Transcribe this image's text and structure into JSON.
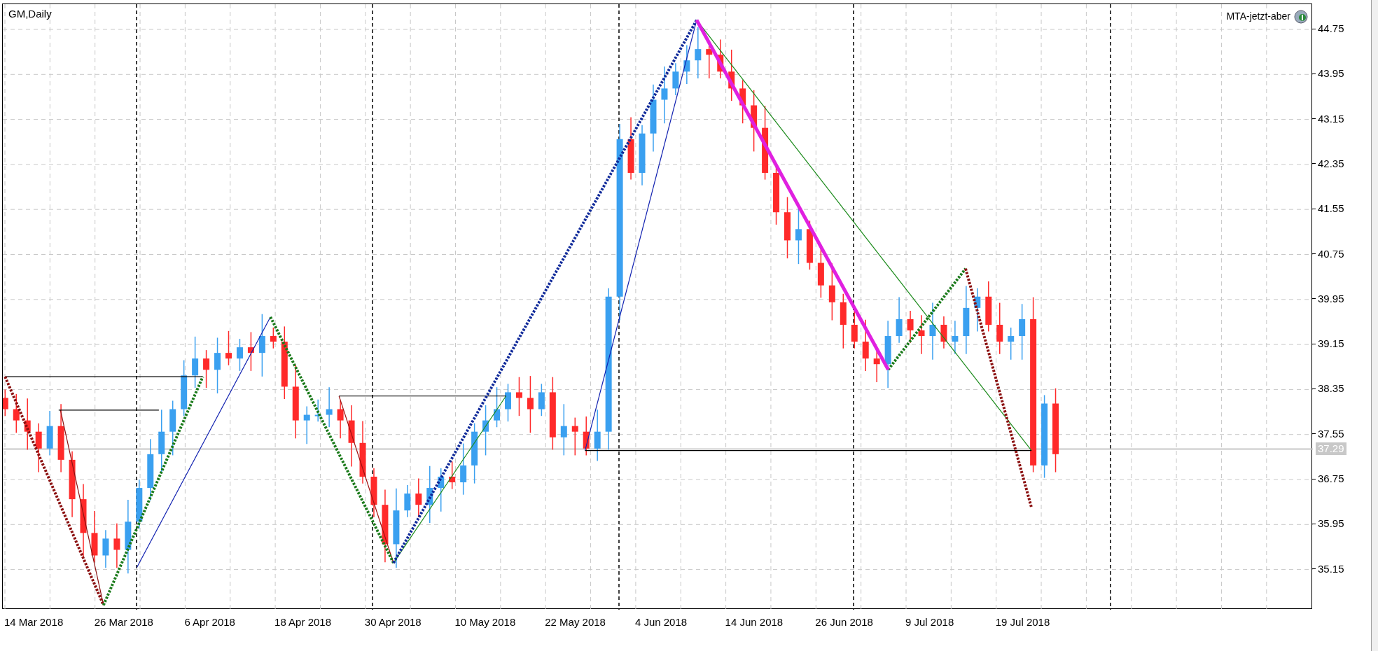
{
  "chart": {
    "title": "GM,Daily",
    "indicator": "MTA-jetzt-aber",
    "current_price": "37.29"
  },
  "y_axis": {
    "labels": [
      "44.75",
      "43.95",
      "43.15",
      "42.35",
      "41.55",
      "40.75",
      "39.95",
      "39.15",
      "38.35",
      "37.55",
      "36.75",
      "35.95",
      "35.15"
    ]
  },
  "x_axis": {
    "labels": [
      "14 Mar 2018",
      "26 Mar 2018",
      "6 Apr 2018",
      "18 Apr 2018",
      "30 Apr 2018",
      "10 May 2018",
      "22 May 2018",
      "4 Jun 2018",
      "14 Jun 2018",
      "26 Jun 2018",
      "9 Jul 2018",
      "19 Jul 2018"
    ]
  }
}
